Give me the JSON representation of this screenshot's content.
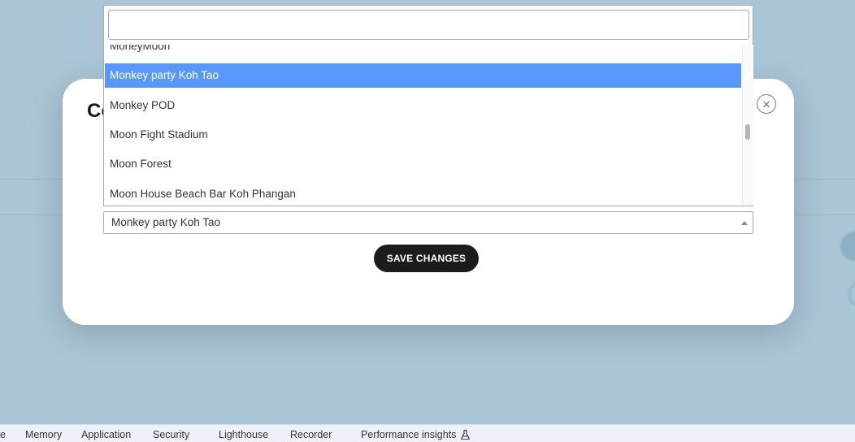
{
  "modal": {
    "title_fragment": "Co",
    "close_label": "×",
    "selected_value": "Monkey party Koh Tao",
    "save_label": "SAVE CHANGES"
  },
  "dropdown": {
    "search_value": "",
    "options": [
      {
        "label": "MoneyMoon",
        "selected": false
      },
      {
        "label": "Monkey party Koh Tao",
        "selected": true
      },
      {
        "label": "Monkey POD",
        "selected": false
      },
      {
        "label": "Moon Fight Stadium",
        "selected": false
      },
      {
        "label": "Moon Forest",
        "selected": false
      },
      {
        "label": "Moon House Beach Bar Koh Phangan",
        "selected": false
      }
    ]
  },
  "devtools": {
    "tabs": [
      "e",
      "Memory",
      "Application",
      "Security",
      "Lighthouse",
      "Recorder",
      "Performance insights"
    ]
  },
  "colors": {
    "backdrop": "#a9c5d6",
    "highlight": "#5897fb",
    "button": "#1c1c1c"
  }
}
